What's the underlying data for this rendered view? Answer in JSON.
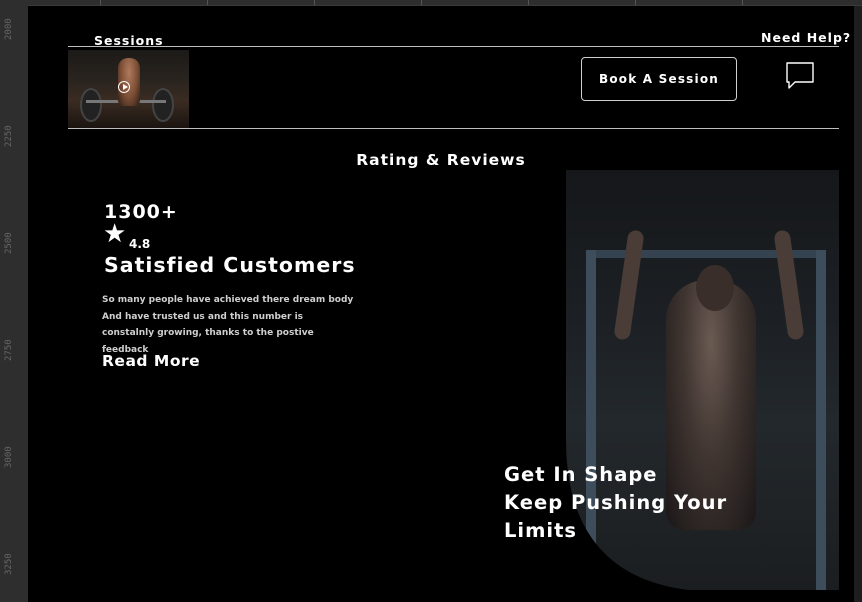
{
  "ruler": {
    "marks": [
      "2000",
      "2250",
      "2500",
      "2750",
      "3000",
      "3250"
    ]
  },
  "header": {
    "sessions_label": "Sessions",
    "help_label": "Need Help?",
    "book_button": "Book A Session",
    "video_thumbnail_icon": "play-icon",
    "help_icon": "chat-bubble-icon"
  },
  "reviews": {
    "title": "Rating & Reviews",
    "count": "1300+",
    "star_icon": "star-icon",
    "rating": "4.8",
    "headline": "Satisfied Customers",
    "description_lines": [
      "So many people have achieved there dream body",
      "And have trusted us and this number is",
      "constalnly growing, thanks  to the postive feedback"
    ],
    "read_more": "Read More"
  },
  "hero": {
    "lines": [
      "Get In Shape",
      "Keep Pushing Your",
      "Limits"
    ]
  },
  "colors": {
    "background": "#000000",
    "canvas": "#2b2b2b",
    "text": "#ffffff",
    "divider": "#bdbdbd"
  }
}
